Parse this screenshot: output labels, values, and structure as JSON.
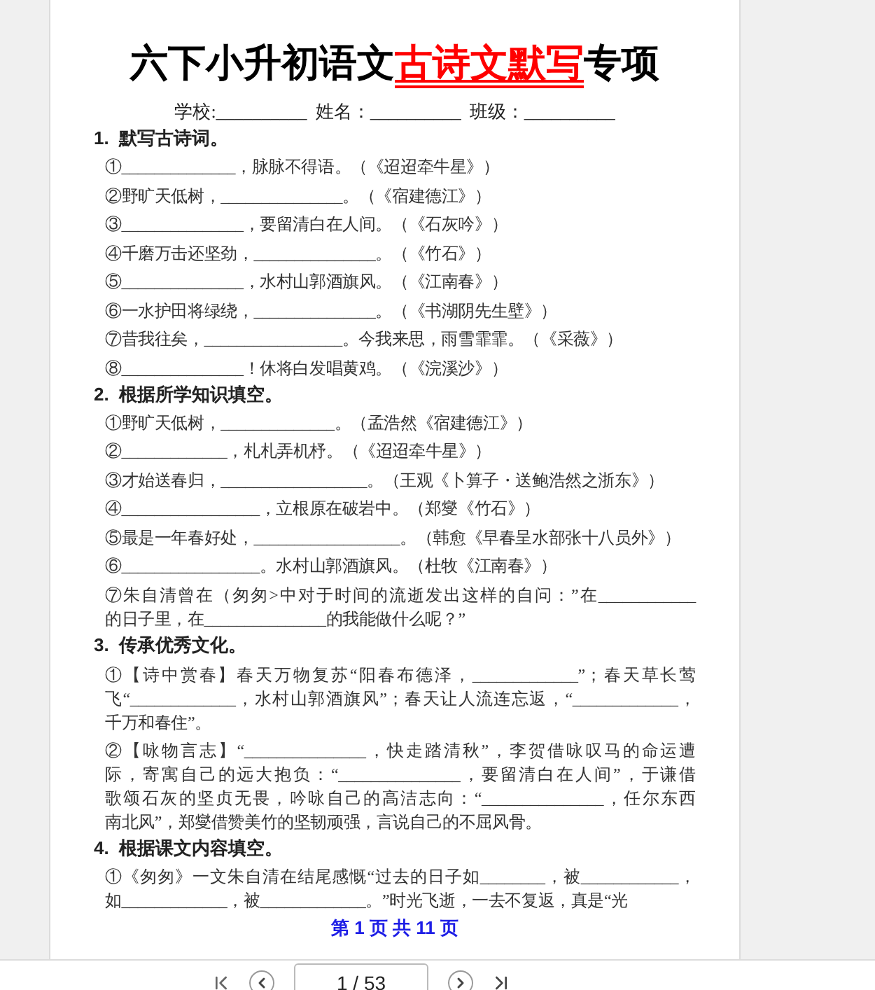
{
  "title": [
    {
      "text": "六下小升初语文",
      "kind": "normal"
    },
    {
      "text": "古诗文默写",
      "kind": "highlight"
    },
    {
      "text": "专项",
      "kind": "normal"
    }
  ],
  "info_fields": [
    "学校:__________",
    "姓名：__________",
    "班级：__________"
  ],
  "sections": [
    {
      "number": "1.",
      "heading": "默写古诗词。",
      "items": [
        {
          "lines": [
            "①______________，脉脉不得语。（《迢迢牵牛星》）"
          ]
        },
        {
          "lines": [
            "②野旷天低树，_______________。（《宿建德江》）"
          ]
        },
        {
          "lines": [
            "③_______________，要留清白在人间。（《石灰吟》）"
          ]
        },
        {
          "lines": [
            "④千磨万击还坚劲，_______________。（《竹石》）"
          ]
        },
        {
          "lines": [
            "⑤_______________，水村山郭酒旗风。（《江南春》）"
          ]
        },
        {
          "lines": [
            "⑥一水护田将绿绕，_______________。（《书湖阴先生壁》）"
          ]
        },
        {
          "lines": [
            "⑦昔我往矣，_________________。今我来思，雨雪霏霏。（《采薇》）"
          ]
        },
        {
          "lines": [
            "⑧_______________！休将白发唱黄鸡。（《浣溪沙》）"
          ]
        }
      ]
    },
    {
      "number": "2.",
      "heading": "根据所学知识填空。",
      "items": [
        {
          "lines": [
            "①野旷天低树，______________。（孟浩然《宿建德江》）"
          ]
        },
        {
          "lines": [
            "②_____________，札札弄机杼。（《迢迢牵牛星》）"
          ]
        },
        {
          "lines": [
            "③才始送春归，__________________。（王观《卜算子・送鲍浩然之浙东》）"
          ]
        },
        {
          "lines": [
            "④_________________，立根原在破岩中。（郑燮《竹石》）"
          ]
        },
        {
          "lines": [
            "⑤最是一年春好处，__________________。（韩愈《早春呈水部张十八员外》）"
          ]
        },
        {
          "lines": [
            "⑥_________________。水村山郭酒旗风。（杜牧《江南春》）"
          ]
        },
        {
          "lines": [
            "⑦朱自清曾在（匆匆>中对于时间的流逝发出这样的自问：”在____________",
            "的日子里，在_______________的我能做什么呢？”"
          ]
        }
      ]
    },
    {
      "number": "3.",
      "heading": "传承优秀文化。",
      "items": [
        {
          "lines": [
            "①【诗中赏春】春天万物复苏“阳春布德泽，_____________”；春天草长莺",
            "飞“_____________，水村山郭酒旗风”；春天让人流连忘返，“_____________，",
            "千万和春住”。"
          ]
        },
        {
          "lines": [
            "②【咏物言志】“_______________，快走踏清秋”，李贺借咏叹马的命运遭",
            "际，寄寓自己的远大抱负：“_______________，要留清白在人间”，于谦借",
            "歌颂石灰的坚贞无畏，吟咏自己的高洁志向：“_______________，任尔东西",
            "南北风”，郑燮借赞美竹的坚韧顽强，言说自己的不屈风骨。"
          ]
        }
      ]
    },
    {
      "number": "4.",
      "heading": "根据课文内容填空。",
      "items": [
        {
          "lines": [
            "①《匆匆》一文朱自清在结尾感慨“过去的日子如________，被____________，",
            "如_____________，被_____________。”时光飞逝，一去不复返，真是“光"
          ]
        }
      ]
    }
  ],
  "page_footer": "第 1 页 共 11 页",
  "toolbar": {
    "page_field": "1 / 53"
  }
}
